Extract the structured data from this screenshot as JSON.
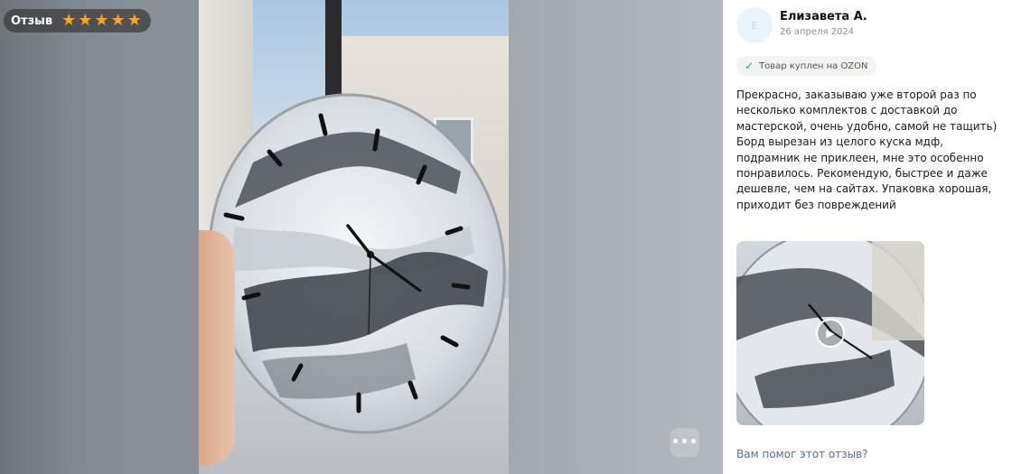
{
  "badge": {
    "label": "Отзыв",
    "rating": 5,
    "max_rating": 5,
    "star_color": "#f9a825"
  },
  "viewer": {
    "more_label": "•••"
  },
  "review": {
    "avatar_letter": "Е",
    "author": "Елизавета А.",
    "date": "26 апреля 2024",
    "bought_badge": "Товар куплен на OZON",
    "text": "Прекрасно, заказываю уже второй раз по несколько комплектов с доставкой до мастерской, очень удобно, самой не тащить) Борд вырезан из целого куска мдф, подрамник не приклеен, мне это особенно понравилось. Рекомендую, быстрее и даже дешевле, чем на сайтах. Упаковка хорошая, приходит без повреждений",
    "helpful_question": "Вам помог этот отзыв?"
  },
  "colors": {
    "accent_check": "#2eaa5c",
    "link": "#5a6e8c"
  }
}
